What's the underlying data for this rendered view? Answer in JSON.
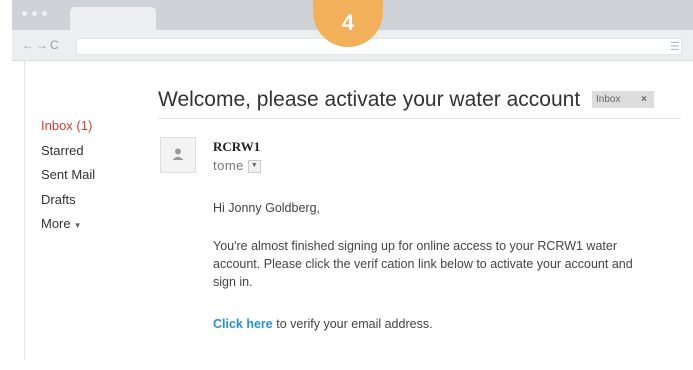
{
  "step": {
    "number": "4"
  },
  "sidebar": {
    "items": [
      {
        "label": "Inbox (1)"
      },
      {
        "label": "Starred"
      },
      {
        "label": "Sent Mail"
      },
      {
        "label": "Drafts"
      },
      {
        "label": "More"
      }
    ]
  },
  "email": {
    "subject": "Welcome, please activate your water account",
    "label": "Inbox",
    "label_close": "×",
    "sender": "RCRW1",
    "recipient": "tome",
    "greeting": "Hi Jonny Goldberg,",
    "paragraph": "You're almost finished signing up for online access to your RCRW1 water account. Please click the verif cation link below to activate your account and sign in.",
    "cta_link": "Click here",
    "cta_text": " to verify your email address."
  },
  "colors": {
    "accent": "#d23f31",
    "link": "#2b8fd0",
    "badge": "#f2b05a"
  },
  "icons": [
    "back-icon",
    "forward-icon",
    "reload-icon",
    "menu-icon",
    "person-icon",
    "dropdown-icon"
  ]
}
